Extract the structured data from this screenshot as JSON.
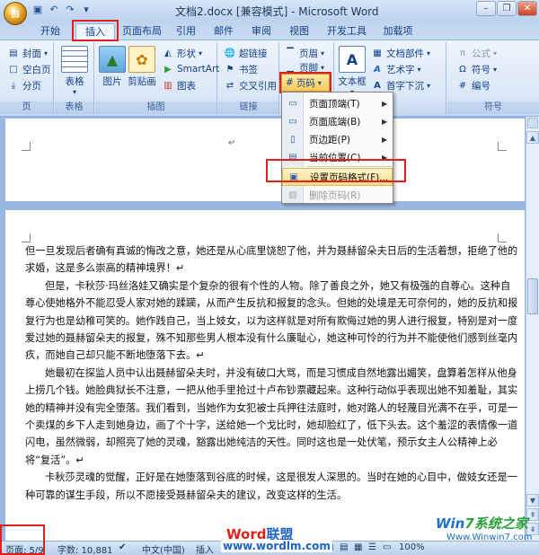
{
  "window": {
    "title": "文档2.docx [兼容模式] - Microsoft Word",
    "quick_access": [
      "save-icon",
      "undo-icon",
      "redo-icon",
      "dropdown-icon"
    ]
  },
  "tabs": [
    {
      "label": "开始",
      "active": false
    },
    {
      "label": "插入",
      "active": true
    },
    {
      "label": "页面布局",
      "active": false
    },
    {
      "label": "引用",
      "active": false
    },
    {
      "label": "邮件",
      "active": false
    },
    {
      "label": "审阅",
      "active": false
    },
    {
      "label": "视图",
      "active": false
    },
    {
      "label": "开发工具",
      "active": false
    },
    {
      "label": "加载项",
      "active": false
    }
  ],
  "ribbon": {
    "pages": {
      "cover": "封面",
      "blank": "空白页",
      "break": "分页",
      "label": "页"
    },
    "table": {
      "button": "表格",
      "label": "表格"
    },
    "illustrations": {
      "picture": "图片",
      "clipart": "剪贴画",
      "shape": "形状",
      "smartart": "SmartArt",
      "chart": "图表",
      "label": "插图"
    },
    "links": {
      "hyperlink": "超链接",
      "bookmark": "书签",
      "crossref": "交叉引用",
      "label": "链接"
    },
    "header_footer": {
      "header": "页眉",
      "footer": "页脚",
      "page_number": "页码"
    },
    "text": {
      "textbox": "文本框",
      "quickparts": "文档部件",
      "wordart": "艺术字",
      "dropcap": "首字下沉"
    },
    "symbols": {
      "equation": "公式",
      "symbol": "符号",
      "number": "编号",
      "label": "符号"
    }
  },
  "page_number_menu": [
    {
      "label": "页面顶端(T)",
      "submenu": true,
      "disabled": false
    },
    {
      "label": "页面底端(B)",
      "submenu": true,
      "disabled": false
    },
    {
      "label": "页边距(P)",
      "submenu": true,
      "disabled": false
    },
    {
      "label": "当前位置(C)",
      "submenu": true,
      "disabled": false
    },
    {
      "label": "设置页码格式(F)...",
      "submenu": false,
      "disabled": false
    },
    {
      "label": "删除页码(R)",
      "submenu": false,
      "disabled": true
    }
  ],
  "document": {
    "paragraphs": [
      {
        "indent": false,
        "text": "但一旦发现后者确有真诚的悔改之意，她还是从心底里饶恕了他，并为聂赫留朵夫日后的生活着想，拒绝了他的求婚，这是多么崇高的精神境界！↵"
      },
      {
        "indent": true,
        "text": "但是，卡秋莎·玛丝洛娃又确实是个复杂的很有个性的人物。除了善良之外，她又有极强的自尊心。这种自尊心使她格外不能忍受人家对她的蹂躏，从而产生反抗和报复的念头。但她的处境是无可奈何的，她的反抗和报复行为也是幼稚可笑的。她作践自己，当上妓女，以为这样就是对所有欺侮过她的男人进行报复，特别是对一度爱过她的聂赫留朵夫的报复，殊不知那些男人根本没有什么廉耻心，她这种可怜的行为并不能使他们感到丝毫内疚，而她自己却只能不断地堕落下去。↵"
      },
      {
        "indent": true,
        "text": "她最初在探监人员中认出聂赫留朵夫时，并没有破口大骂，而是习惯成自然地露出媚笑，盘算着怎样从他身上捞几个钱。她脸典狱长不注意，一把从他手里抢过十卢布钞票藏起来。这种行动似乎表现出她不知羞耻，其实她的精神并没有完全堕落。我们看到，当她作为女犯被士兵押往法庭时，她对路人的轻蔑目光满不在乎，可是一个卖煤的乡下人走到她身边，画了个十字，送给她一个戈比时，她却脸红了，低下头去。这个羞涩的表情像一道闪电，虽然微弱，却照亮了她的灵魂，豁露出她纯洁的天性。同时这也是一处伏笔，预示女主人公精神上必将“复活”。↵"
      },
      {
        "indent": true,
        "text": "卡秋莎灵魂的觉醒，正好是在她堕落到谷底的时候，这是很发人深思的。当时在她的心目中，做妓女还是一种可靠的谋生手段，所以不愿接受聂赫留朵夫的建议，改变这样的生活。"
      }
    ]
  },
  "statusbar": {
    "page": "页面: 5/9",
    "words": "字数: 10,881",
    "language": "中文(中国)",
    "mode": "插入",
    "zoom": "100%"
  },
  "watermarks": {
    "word_part1": "Word",
    "word_part2": "联盟",
    "url": "www.wordlm.com",
    "win7_a": "Win",
    "win7_b": "7系统之家",
    "win7_url": "Www.Winwin7.com"
  }
}
